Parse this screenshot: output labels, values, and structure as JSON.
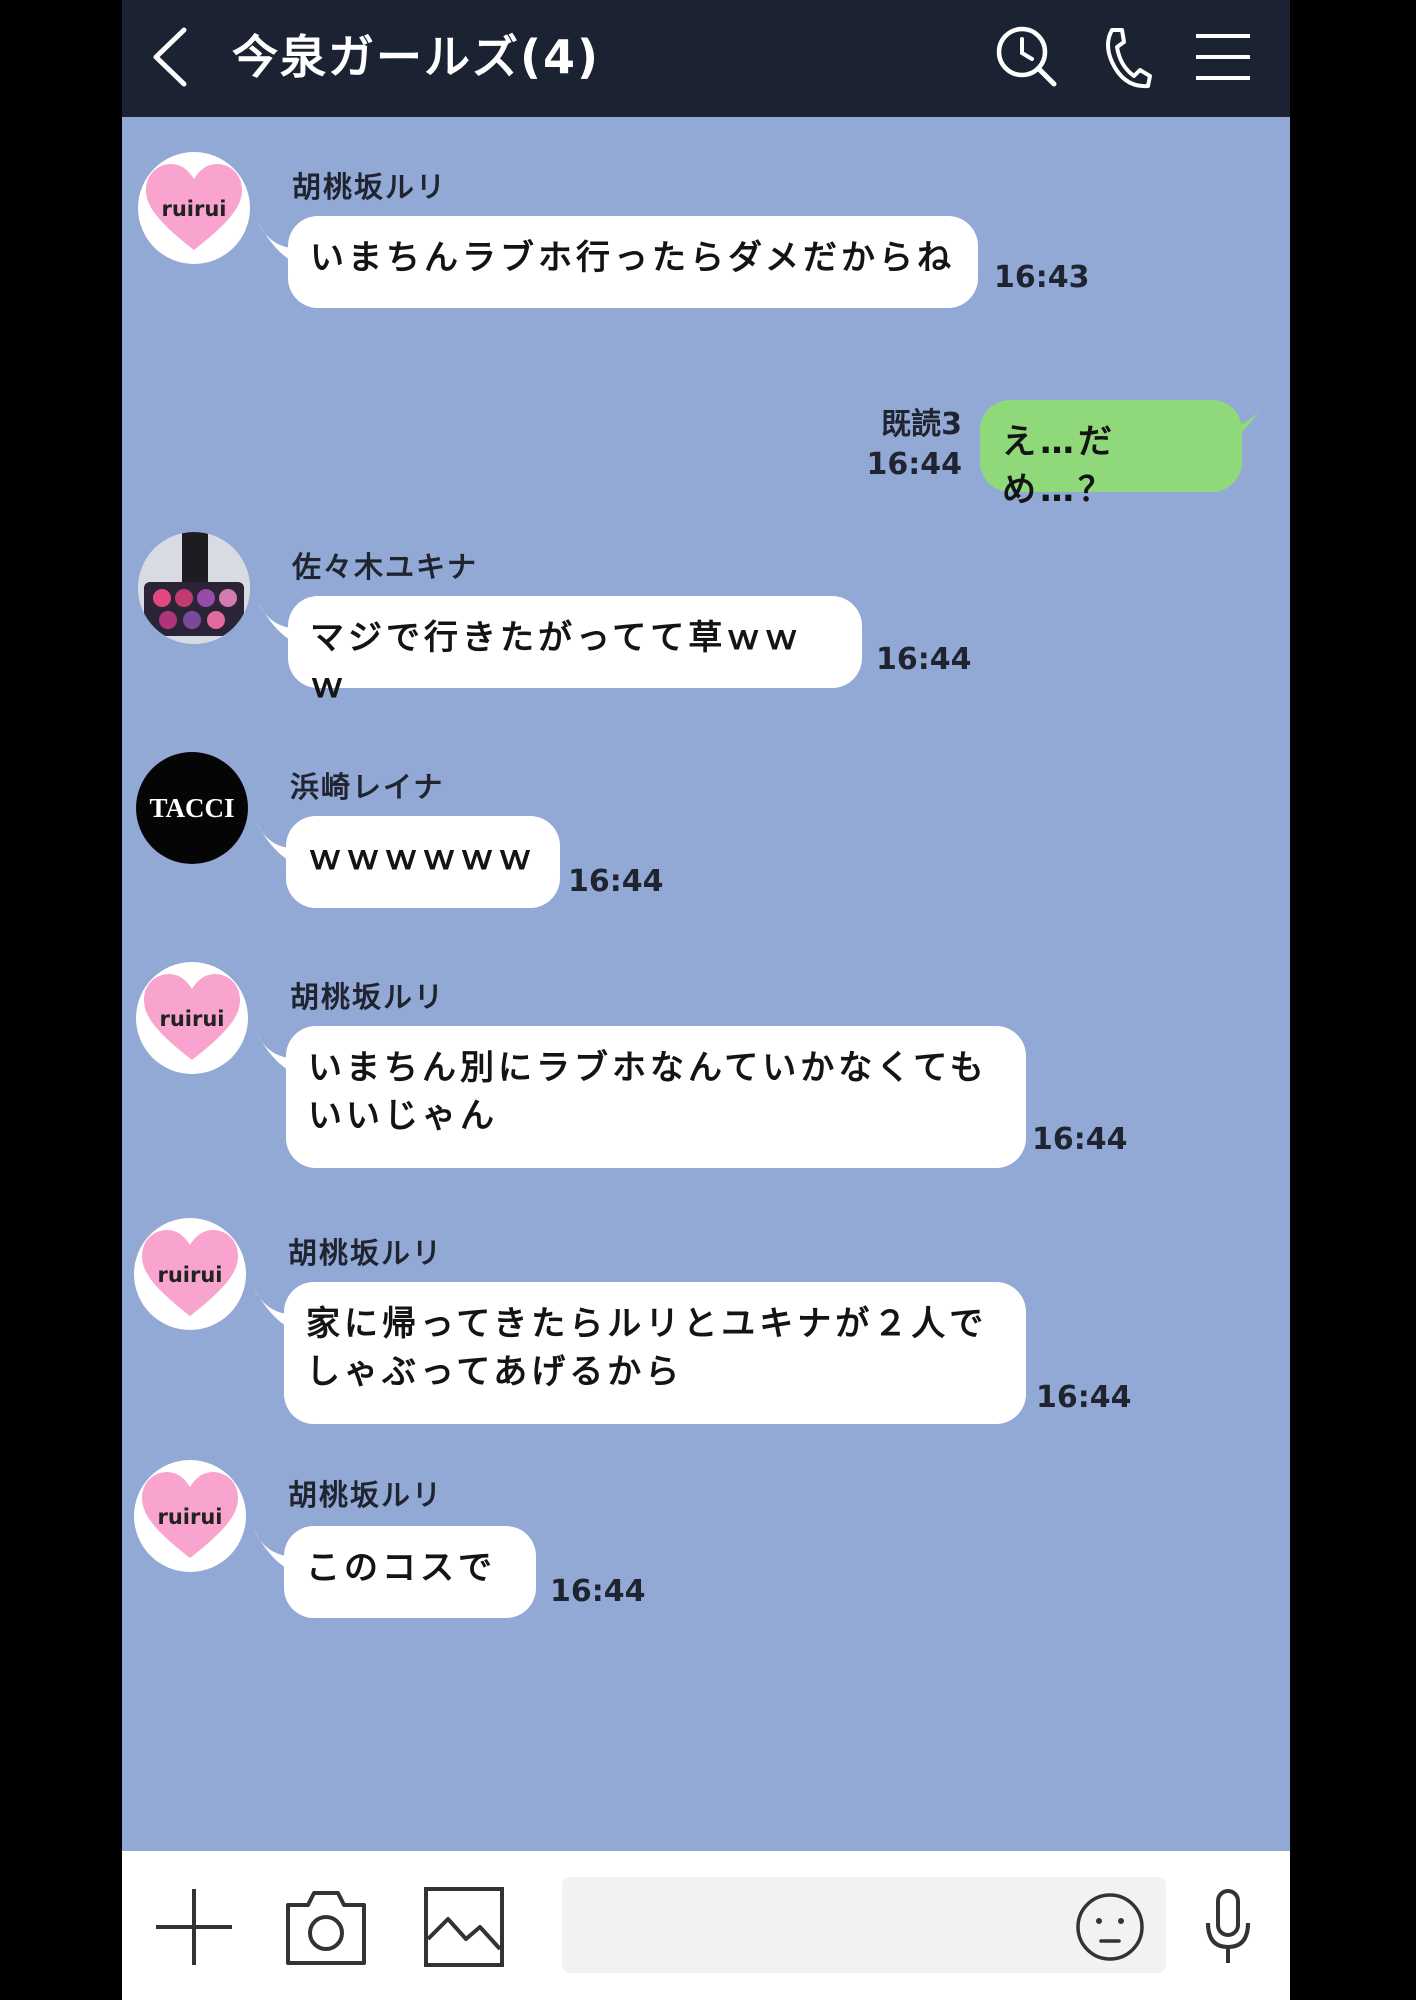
{
  "header": {
    "title": "今泉ガールズ(4)",
    "icons": [
      "chevron-left-icon",
      "search-clock-icon",
      "phone-icon",
      "menu-icon"
    ]
  },
  "messages": [
    {
      "sender": "胡桃坂ルリ",
      "avatar_text": "ruirui",
      "text": "いまちんラブホ行ったらダメだからね",
      "time": "16:43"
    },
    {
      "outgoing": true,
      "read": "既読3",
      "time": "16:44",
      "text": "え…だめ…？"
    },
    {
      "sender": "佐々木ユキナ",
      "text": "マジで行きたがってて草ｗｗｗ",
      "time": "16:44"
    },
    {
      "sender": "浜崎レイナ",
      "avatar_text": "TACCI",
      "text": "ｗｗｗｗｗｗ",
      "time": "16:44"
    },
    {
      "sender": "胡桃坂ルリ",
      "avatar_text": "ruirui",
      "text": "いまちん別にラブホなんていかなくても\nいいじゃん",
      "time": "16:44"
    },
    {
      "sender": "胡桃坂ルリ",
      "avatar_text": "ruirui",
      "text": "家に帰ってきたらルリとユキナが２人で\nしゃぶってあげるから",
      "time": "16:44"
    },
    {
      "sender": "胡桃坂ルリ",
      "avatar_text": "ruirui",
      "text": "このコスで",
      "time": "16:44"
    }
  ],
  "footer": {
    "input_value": "",
    "icons": [
      "plus-icon",
      "camera-icon",
      "image-icon",
      "emoji-icon",
      "microphone-icon"
    ]
  },
  "colors": {
    "header_bg": "#1b2333",
    "chat_bg": "#93a9d5",
    "incoming_bubble": "#ffffff",
    "outgoing_bubble": "#8fd97a",
    "heart_pink": "#f9a3cf"
  }
}
